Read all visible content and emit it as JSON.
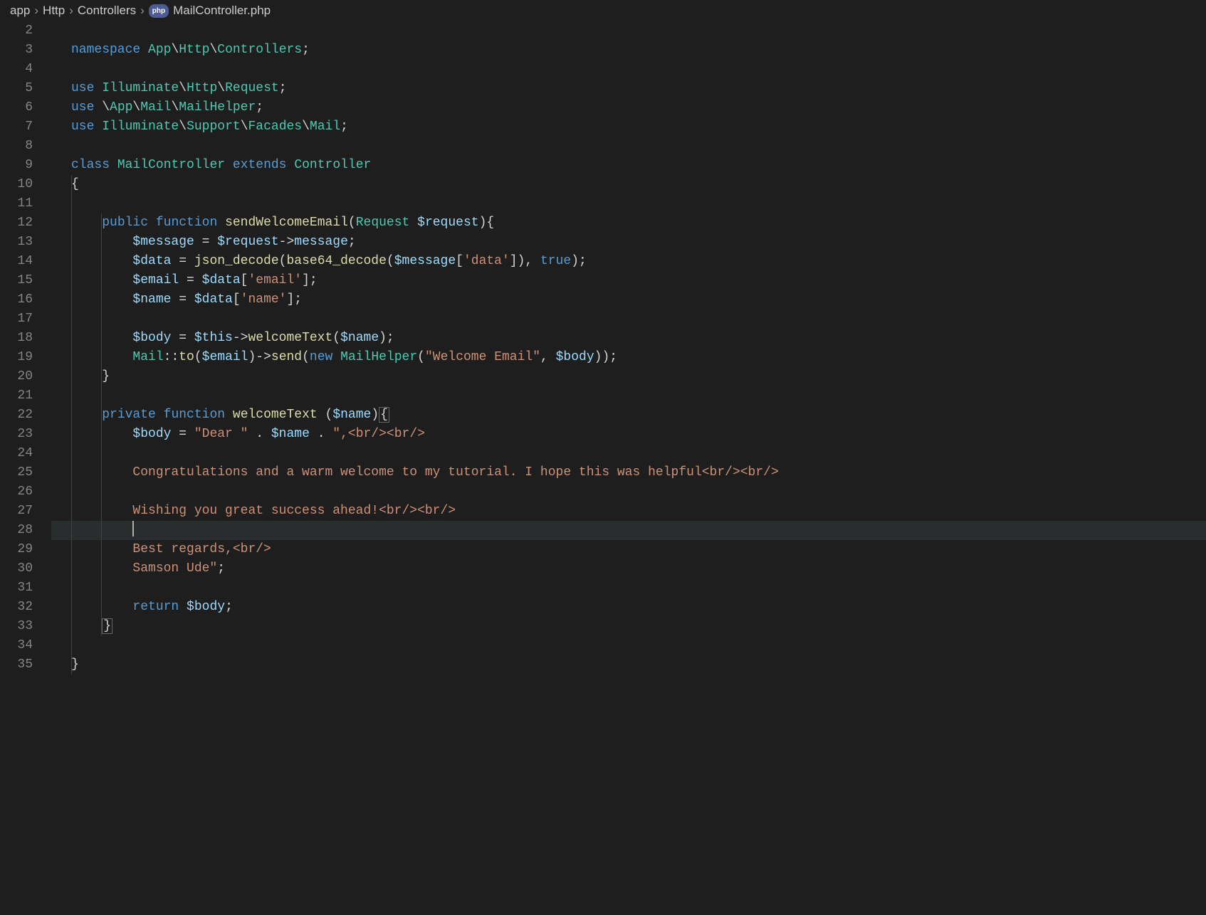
{
  "breadcrumb": {
    "seg1": "app",
    "seg2": "Http",
    "seg3": "Controllers",
    "file": "MailController.php",
    "icon_label": "php"
  },
  "gutter": {
    "start": 2,
    "end": 35
  },
  "code": {
    "l3": {
      "kw_ns": "namespace",
      "ns1": "App",
      "ns2": "Http",
      "ns3": "Controllers"
    },
    "l5": {
      "kw": "use",
      "n1": "Illuminate",
      "n2": "Http",
      "cls": "Request"
    },
    "l6": {
      "kw": "use",
      "n1": "App",
      "n2": "Mail",
      "cls": "MailHelper"
    },
    "l7": {
      "kw": "use",
      "n1": "Illuminate",
      "n2": "Support",
      "n3": "Facades",
      "cls": "Mail"
    },
    "l9": {
      "kw_class": "class",
      "name": "MailController",
      "kw_ext": "extends",
      "parent": "Controller"
    },
    "l12": {
      "vis": "public",
      "kw_fn": "function",
      "name": "sendWelcomeEmail",
      "ptype": "Request",
      "pvar": "$request"
    },
    "l13": {
      "v1": "$message",
      "v2": "$request",
      "prop": "message"
    },
    "l14": {
      "v1": "$data",
      "fn1": "json_decode",
      "fn2": "base64_decode",
      "v2": "$message",
      "key": "'data'",
      "bool": "true"
    },
    "l15": {
      "v1": "$email",
      "v2": "$data",
      "key": "'email'"
    },
    "l16": {
      "v1": "$name",
      "v2": "$data",
      "key": "'name'"
    },
    "l18": {
      "v1": "$body",
      "v2": "$this",
      "fn": "welcomeText",
      "arg": "$name"
    },
    "l19": {
      "cls": "Mail",
      "fn1": "to",
      "arg1": "$email",
      "fn2": "send",
      "kw_new": "new",
      "cls2": "MailHelper",
      "s1": "\"Welcome Email\"",
      "arg2": "$body"
    },
    "l22": {
      "vis": "private",
      "kw_fn": "function",
      "name": "welcomeText",
      "pvar": "$name"
    },
    "l23": {
      "v1": "$body",
      "s1": "\"Dear \"",
      "v2": "$name",
      "s2": "\",<br/><br/>"
    },
    "l25": {
      "s": "        Congratulations and a warm welcome to my tutorial. I hope this was helpful<br/><br/>"
    },
    "l27": {
      "s": "        Wishing you great success ahead!<br/><br/>"
    },
    "l29": {
      "s": "        Best regards,<br/>"
    },
    "l30": {
      "s": "        Samson Ude\""
    },
    "l32": {
      "kw": "return",
      "v": "$body"
    }
  }
}
